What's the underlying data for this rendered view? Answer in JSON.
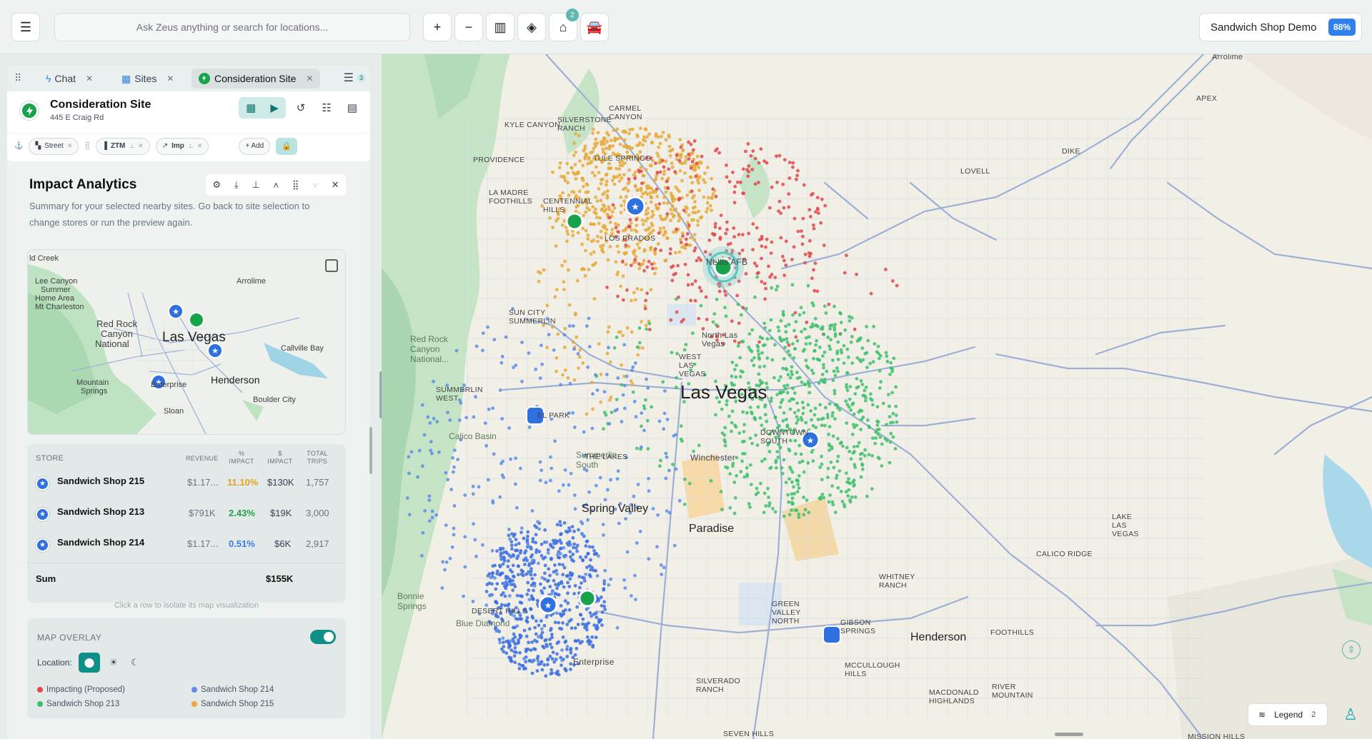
{
  "topbar": {
    "search_placeholder": "Ask Zeus anything or search for locations...",
    "store_badge": "2",
    "project_name": "Sandwich Shop Demo",
    "project_pct": "88%"
  },
  "tabs": [
    {
      "label": "Chat"
    },
    {
      "label": "Sites"
    },
    {
      "label": "Consideration Site"
    }
  ],
  "tab_list_count": "3",
  "site": {
    "title": "Consideration Site",
    "address": "445 E Craig Rd"
  },
  "chips": {
    "street": "Street",
    "ztm": "ZTM",
    "imp": "Imp",
    "add": "+ Add"
  },
  "impact": {
    "title": "Impact Analytics",
    "subtitle": "Summary for your selected nearby sites. Go back to site selection to change stores or run the preview again."
  },
  "minimap_labels": [
    "ld Creek",
    "Lee Canyon",
    "Summer",
    "Home Area",
    "Mt Charleston",
    "Red Rock",
    "Canyon",
    "National",
    "Las Vegas",
    "Arrolime",
    "Callville Bay",
    "Henderson",
    "Enterprise",
    "Mountain",
    "Springs",
    "Sloan",
    "Boulder City"
  ],
  "table": {
    "headers": [
      "STORE",
      "REVENUE",
      "% IMPACT",
      "$ IMPACT",
      "TOTAL TRIPS"
    ],
    "rows": [
      {
        "store": "Sandwich Shop 215",
        "revenue": "$1.17...",
        "pct": "11.10%",
        "pct_color": "#e0a322",
        "dollar": "$130K",
        "trips": "1,757"
      },
      {
        "store": "Sandwich Shop 213",
        "revenue": "$791K",
        "pct": "2.43%",
        "pct_color": "#22a04b",
        "dollar": "$19K",
        "trips": "3,000"
      },
      {
        "store": "Sandwich Shop 214",
        "revenue": "$1.17...",
        "pct": "0.51%",
        "pct_color": "#3b7be6",
        "dollar": "$6K",
        "trips": "2,917"
      }
    ],
    "sum_label": "Sum",
    "sum_value": "$155K",
    "hint": "Click a row to isolate its map visualization"
  },
  "overlay": {
    "title": "MAP OVERLAY",
    "location_label": "Location:",
    "legend": [
      {
        "label": "Impacting (Proposed)",
        "color": "#e0484b"
      },
      {
        "label": "Sandwich Shop 214",
        "color": "#5b8de8"
      },
      {
        "label": "Sandwich Shop 213",
        "color": "#3fbf6b"
      },
      {
        "label": "Sandwich Shop 215",
        "color": "#e6a93a"
      }
    ]
  },
  "map": {
    "legend_label": "Legend",
    "legend_count": "2",
    "labels": {
      "las_vegas": "Las Vegas",
      "spring_valley": "Spring Valley",
      "paradise": "Paradise",
      "henderson": "Henderson",
      "north_las_vegas": "North Las Vegas",
      "winchester": "Winchester",
      "enterprise": "Enterprise",
      "nellis": "Nellis AFB",
      "red_rock": "Red Rock Canyon National...",
      "calico": "Calico Basin",
      "bonnie": "Bonnie Springs",
      "blue_diamond": "Blue Diamond",
      "summerlin": "Summerlin South",
      "summerlin_west": "SUMMERLIN WEST",
      "the_lakes": "THE LAKES",
      "desert_hills": "DESERT HILLS",
      "sun_city": "SUN CITY SUMMERLIN",
      "centennial": "CENTENNIAL HILLS",
      "la_madre": "LA MADRE FOOTHILLS",
      "providence": "PROVIDENCE",
      "kyle": "KYLE CANYON",
      "silverstone": "SILVERSTONE RANCH",
      "carmel": "CARMEL CANYON",
      "tule": "TULE SPRINGS",
      "los_prados": "LOS PRADOS",
      "lovell": "LOVELL",
      "dike": "DIKE",
      "apex": "APEX",
      "arrolime": "Arrolime",
      "west_lv": "WEST LAS VEGAS",
      "downtown": "DOWNTOWN SOUTH",
      "el_park": "EL PARK",
      "calico_ridge": "CALICO RIDGE",
      "lake_las_vegas": "LAKE LAS VEGAS",
      "whitney": "WHITNEY RANCH",
      "green_valley": "GREEN VALLEY NORTH",
      "gibson": "GIBSON SPRINGS",
      "mccullough": "MCCULLOUGH HILLS",
      "silverado": "SILVERADO RANCH",
      "seven_hills": "SEVEN HILLS",
      "macdonald": "MACDONALD HIGHLANDS",
      "foothills": "FOOTHILLS",
      "river_mountain": "RIVER MOUNTAIN",
      "mission_hills": "MISSION HILLS"
    }
  }
}
